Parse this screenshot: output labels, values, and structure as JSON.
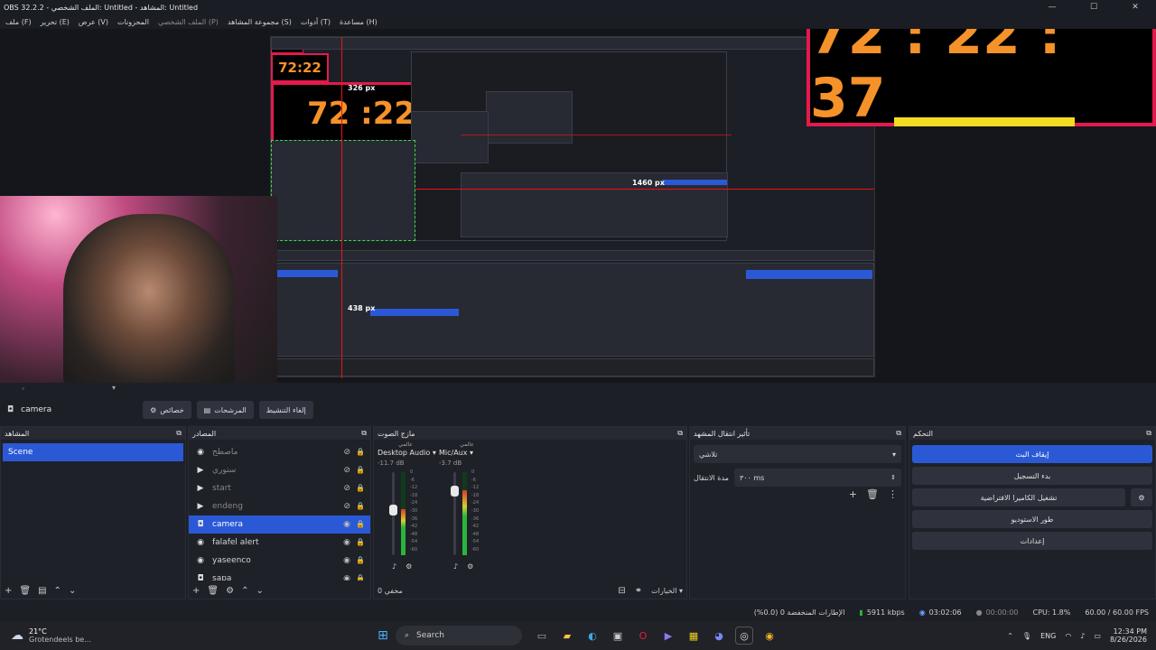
{
  "window": {
    "title": "OBS 32.2.2 - الملف الشخصي: Untitled - المشاهد: Untitled"
  },
  "menu": [
    {
      "label": "ملف (F)",
      "dim": false
    },
    {
      "label": "تحرير (E)",
      "dim": false
    },
    {
      "label": "عرض (V)",
      "dim": false
    },
    {
      "label": "المحزونات",
      "dim": false
    },
    {
      "label": "الملف الشخصي (P)",
      "dim": true
    },
    {
      "label": "مجموعة المشاهد (S)",
      "dim": false
    },
    {
      "label": "أدوات (T)",
      "dim": false
    },
    {
      "label": "مساعدة (H)",
      "dim": false
    }
  ],
  "preview": {
    "clock_text": "72 : 22 : 37",
    "clock_small_1": "72:22",
    "clock_small_2": "72:22",
    "clock_small_3": "72 :22",
    "measure_top": "326 px",
    "measure_right": "1460 px",
    "measure_left": "438 px"
  },
  "source_toolbar": {
    "source_name": "camera",
    "properties_label": "خصائص",
    "filters_label": "المرشحات",
    "deactivate_label": "إلغاء التنشيط"
  },
  "docks": {
    "scenes": {
      "title": "المشاهد",
      "items": [
        "Scene"
      ]
    },
    "sources": {
      "title": "المصادر",
      "items": [
        {
          "name": "ماصطح",
          "icon": "◉",
          "selected": false,
          "hidden": true
        },
        {
          "name": "ستوري",
          "icon": "▶",
          "selected": false,
          "hidden": true
        },
        {
          "name": "start",
          "icon": "▶",
          "selected": false,
          "hidden": true
        },
        {
          "name": "endeng",
          "icon": "▶",
          "selected": false,
          "hidden": true
        },
        {
          "name": "camera",
          "icon": "◘",
          "selected": true,
          "hidden": false
        },
        {
          "name": "falafel alert",
          "icon": "◉",
          "selected": false,
          "hidden": false
        },
        {
          "name": "yaseenco",
          "icon": "◉",
          "selected": false,
          "hidden": false
        },
        {
          "name": "sapa",
          "icon": "◘",
          "selected": false,
          "hidden": false
        }
      ]
    },
    "mixer": {
      "title": "مازج الصوت",
      "channels": [
        {
          "tag": "عالمي",
          "name": "Desktop Audio",
          "db": "-11.7 dB",
          "level": 0.55
        },
        {
          "tag": "عالمي",
          "name": "Mic/Aux",
          "db": "-3.7 dB",
          "level": 0.78
        }
      ],
      "scale": [
        "0",
        "-6",
        "-12",
        "-18",
        "-24",
        "-30",
        "-36",
        "-42",
        "-48",
        "-54",
        "-60"
      ],
      "muted_label": "مخفي 0",
      "options_label": "الخيارات"
    },
    "transitions": {
      "title": "تأثير انتقال المشهد",
      "selected": "تلاشي",
      "duration_label": "مدة الانتقال",
      "duration_value": "٣٠٠ ms"
    },
    "controls": {
      "title": "التحكم",
      "buttons": [
        "إيقاف البث",
        "بدء التسجيل",
        "تشغيل الكاميرا الافتراضية",
        "طور الاستوديو",
        "إعدادات"
      ]
    }
  },
  "status": {
    "dropped_frames": "الإطارات المنخفضة 0 (0.0%)",
    "bitrate": "5911 kbps",
    "stream_time": "03:02:06",
    "rec_time": "00:00:00",
    "cpu": "CPU: 1.8%",
    "fps": "60.00 / 60.00 FPS"
  },
  "taskbar": {
    "weather_temp": "21°C",
    "weather_desc": "Grotendeels be...",
    "search_label": "Search",
    "lang": "ENG",
    "time": "12:34 PM",
    "date": "8/26/2026"
  },
  "colors": {
    "accent": "#2b59d6",
    "clock_orange": "#f5922a",
    "clock_border": "#e5194d",
    "guide_red": "#ee1111"
  }
}
